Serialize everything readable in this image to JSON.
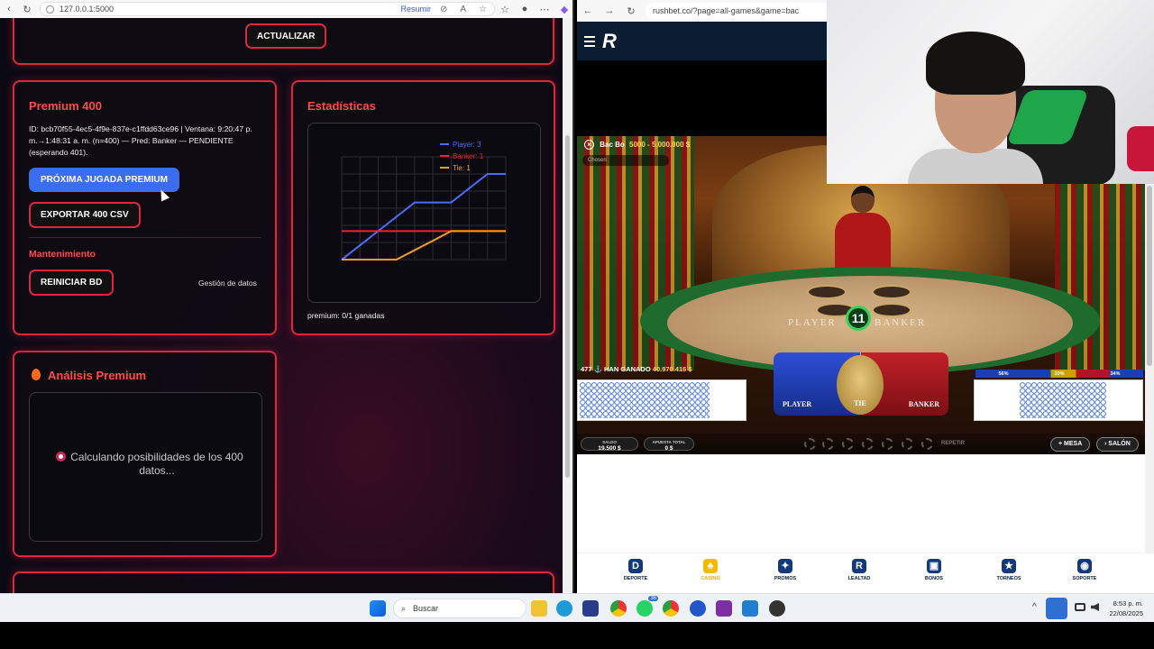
{
  "left_browser": {
    "url": "127.0.0.1:5000",
    "resumir": "Resumir"
  },
  "top_card": {
    "update_button": "ACTUALIZAR"
  },
  "premium_card": {
    "title": "Premium 400",
    "info": "ID: bcb70f55-4ec5-4f9e-837e-c1ffdd63ce96 | Ventana: 9:20:47 p. m.→1:48:31 a. m. (n=400) — Pred: Banker — PENDIENTE (esperando 401).",
    "next_button": "PRÓXIMA JUGADA PREMIUM",
    "export_button": "EXPORTAR 400 CSV",
    "maintenance_title": "Mantenimiento",
    "reset_button": "REINICIAR BD",
    "data_mgmt": "Gestión de datos"
  },
  "stats_card": {
    "title": "Estadísticas",
    "footer": "premium: 0/1 ganadas"
  },
  "chart_data": {
    "type": "line",
    "x": [
      0,
      1,
      2,
      3,
      4,
      5,
      6,
      7,
      8,
      9
    ],
    "series": [
      {
        "name": "Player: 3",
        "color": "#4a6cf7",
        "values": [
          0,
          0.5,
          1,
          1.5,
          2,
          2,
          2,
          2.5,
          3,
          3
        ]
      },
      {
        "name": "Banker: 1",
        "color": "#e8262e",
        "values": [
          1,
          1,
          1,
          1,
          1,
          1,
          1,
          1,
          1,
          1
        ]
      },
      {
        "name": "Tie: 1",
        "color": "#f0a020",
        "values": [
          0,
          0,
          0,
          0,
          0.33,
          0.66,
          1,
          1,
          1,
          1
        ]
      }
    ],
    "ylim": [
      0,
      3.6
    ],
    "grid": true,
    "legend": "top-right"
  },
  "analysis_card": {
    "title": "Análisis Premium",
    "status": "Calculando posibilidades de los 400 datos..."
  },
  "right_browser": {
    "url": "rushbet.co/?page=all-games&game=bac",
    "logo": "R"
  },
  "game": {
    "title": "Bac Bo",
    "limits": "5000 - 5.000.000 $",
    "chosen": "Chosen",
    "timer": "11",
    "player_table": "PLAYER",
    "banker_table": "BANKER",
    "won_prefix": "477 ⚓ HAN GANADO",
    "won_amount": "40.970.416 $",
    "bet_player": "PLAYER",
    "bet_tie": "TIE",
    "bet_banker": "BANKER",
    "stats_player": "56%",
    "stats_tie": "10%",
    "stats_banker": "34%",
    "balance_label": "SALDO",
    "balance_value": "19.500 $",
    "total_label": "APUESTA TOTAL",
    "total_value": "0 $",
    "repeat": "REPETIR",
    "mesa": "MESA",
    "salon": "SALÓN"
  },
  "site_nav": [
    {
      "label": "DEPORTE",
      "glyph": "D"
    },
    {
      "label": "CASINO",
      "glyph": "♣"
    },
    {
      "label": "PROMOS",
      "glyph": "✦"
    },
    {
      "label": "LEALTAD",
      "glyph": "R"
    },
    {
      "label": "BONOS",
      "glyph": "▣"
    },
    {
      "label": "TORNEOS",
      "glyph": "★"
    },
    {
      "label": "SOPORTE",
      "glyph": "◉"
    }
  ],
  "taskbar": {
    "search_placeholder": "Buscar",
    "time": "8:53 p. m.",
    "date": "22/08/2025",
    "whatsapp_badge": "36"
  }
}
